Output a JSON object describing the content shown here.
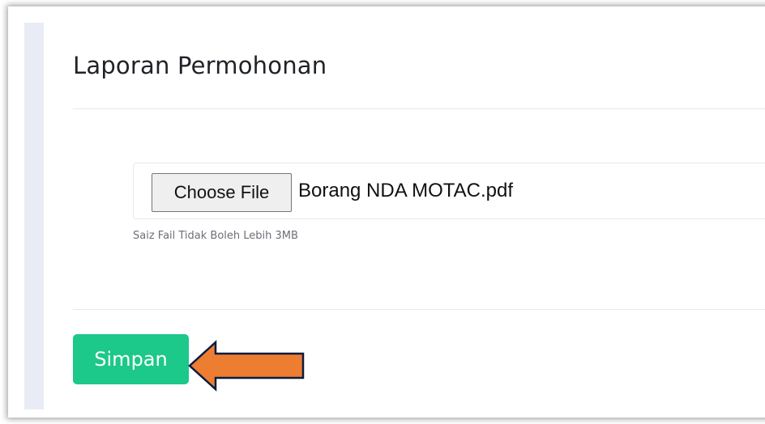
{
  "card": {
    "title": "Laporan Permohonan"
  },
  "file_input": {
    "button_label": "Choose File",
    "file_name": "Borang NDA MOTAC.pdf",
    "help_text": "Saiz Fail Tidak Boleh Lebih 3MB"
  },
  "actions": {
    "save_label": "Simpan"
  },
  "colors": {
    "save_button": "#1cc88a",
    "arrow_fill": "#ed7d31",
    "arrow_stroke": "#0b1b3f"
  },
  "annotation": {
    "icon": "arrow-left-icon"
  }
}
